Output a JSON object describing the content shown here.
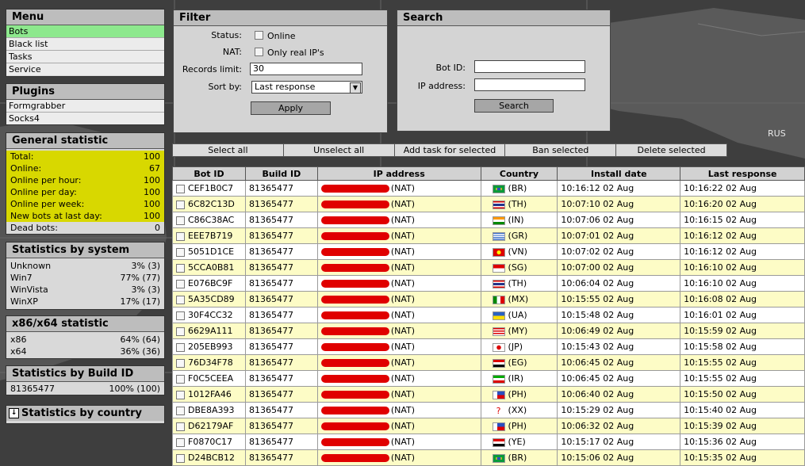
{
  "menu": {
    "title": "Menu",
    "items": [
      {
        "label": "Bots",
        "active": true
      },
      {
        "label": "Black list"
      },
      {
        "label": "Tasks"
      },
      {
        "label": "Service"
      }
    ]
  },
  "plugins": {
    "title": "Plugins",
    "items": [
      {
        "label": "Formgrabber"
      },
      {
        "label": "Socks4"
      }
    ]
  },
  "general": {
    "title": "General statistic",
    "rows": [
      {
        "label": "Total:",
        "value": "100"
      },
      {
        "label": "Online:",
        "value": "67"
      },
      {
        "label": "Online per hour:",
        "value": "100"
      },
      {
        "label": "Online per day:",
        "value": "100"
      },
      {
        "label": "Online per week:",
        "value": "100"
      },
      {
        "label": "New bots at last day:",
        "value": "100"
      },
      {
        "label": "Dead bots:",
        "value": "0"
      }
    ]
  },
  "bysystem": {
    "title": "Statistics by system",
    "rows": [
      {
        "label": "Unknown",
        "value": "3% (3)"
      },
      {
        "label": "Win7",
        "value": "77% (77)"
      },
      {
        "label": "WinVista",
        "value": "3% (3)"
      },
      {
        "label": "WinXP",
        "value": "17% (17)"
      }
    ]
  },
  "arch": {
    "title": "x86/x64 statistic",
    "rows": [
      {
        "label": "x86",
        "value": "64% (64)"
      },
      {
        "label": "x64",
        "value": "36% (36)"
      }
    ]
  },
  "bybuild": {
    "title": "Statistics by Build ID",
    "rows": [
      {
        "label": "81365477",
        "value": "100% (100)"
      }
    ]
  },
  "bycountry": {
    "title": "Statistics by country"
  },
  "filter": {
    "title": "Filter",
    "status_label": "Status:",
    "status_option": "Online",
    "nat_label": "NAT:",
    "nat_option": "Only real IP's",
    "limit_label": "Records limit:",
    "limit_value": "30",
    "sort_label": "Sort by:",
    "sort_value": "Last response",
    "apply": "Apply"
  },
  "search": {
    "title": "Search",
    "botid_label": "Bot ID:",
    "ip_label": "IP address:",
    "button": "Search"
  },
  "actions": [
    "Select all",
    "Unselect all",
    "Add task for selected",
    "Ban selected",
    "Delete selected"
  ],
  "grid": {
    "columns": [
      "Bot ID",
      "Build ID",
      "IP address",
      "Country",
      "Install date",
      "Last response"
    ],
    "rows": [
      {
        "id": "CEF1B0C7",
        "build": "81365477",
        "ip": "(NAT)",
        "cc": "(BR)",
        "flag": "br",
        "install": "10:16:12 02 Aug",
        "last": "10:16:22 02 Aug"
      },
      {
        "id": "6C82C13D",
        "build": "81365477",
        "ip": "(NAT)",
        "cc": "(TH)",
        "flag": "th",
        "install": "10:07:10 02 Aug",
        "last": "10:16:20 02 Aug"
      },
      {
        "id": "C86C38AC",
        "build": "81365477",
        "ip": "(NAT)",
        "cc": "(IN)",
        "flag": "in",
        "install": "10:07:06 02 Aug",
        "last": "10:16:15 02 Aug"
      },
      {
        "id": "EEE7B719",
        "build": "81365477",
        "ip": "(NAT)",
        "cc": "(GR)",
        "flag": "gr",
        "install": "10:07:01 02 Aug",
        "last": "10:16:12 02 Aug"
      },
      {
        "id": "5051D1CE",
        "build": "81365477",
        "ip": "(NAT)",
        "cc": "(VN)",
        "flag": "vn",
        "install": "10:07:02 02 Aug",
        "last": "10:16:12 02 Aug"
      },
      {
        "id": "5CCA0B81",
        "build": "81365477",
        "ip": "(NAT)",
        "cc": "(SG)",
        "flag": "sg",
        "install": "10:07:00 02 Aug",
        "last": "10:16:10 02 Aug"
      },
      {
        "id": "E076BC9F",
        "build": "81365477",
        "ip": "(NAT)",
        "cc": "(TH)",
        "flag": "th",
        "install": "10:06:04 02 Aug",
        "last": "10:16:10 02 Aug"
      },
      {
        "id": "5A35CD89",
        "build": "81365477",
        "ip": "(NAT)",
        "cc": "(MX)",
        "flag": "mx",
        "install": "10:15:55 02 Aug",
        "last": "10:16:08 02 Aug"
      },
      {
        "id": "30F4CC32",
        "build": "81365477",
        "ip": "(NAT)",
        "cc": "(UA)",
        "flag": "ua",
        "install": "10:15:48 02 Aug",
        "last": "10:16:01 02 Aug"
      },
      {
        "id": "6629A111",
        "build": "81365477",
        "ip": "(NAT)",
        "cc": "(MY)",
        "flag": "my",
        "install": "10:06:49 02 Aug",
        "last": "10:15:59 02 Aug"
      },
      {
        "id": "205EB993",
        "build": "81365477",
        "ip": "(NAT)",
        "cc": "(JP)",
        "flag": "jp",
        "install": "10:15:43 02 Aug",
        "last": "10:15:58 02 Aug"
      },
      {
        "id": "76D34F78",
        "build": "81365477",
        "ip": "(NAT)",
        "cc": "(EG)",
        "flag": "eg",
        "install": "10:06:45 02 Aug",
        "last": "10:15:55 02 Aug"
      },
      {
        "id": "F0C5CEEA",
        "build": "81365477",
        "ip": "(NAT)",
        "cc": "(IR)",
        "flag": "ir",
        "install": "10:06:45 02 Aug",
        "last": "10:15:55 02 Aug"
      },
      {
        "id": "1012FA46",
        "build": "81365477",
        "ip": "(NAT)",
        "cc": "(PH)",
        "flag": "ph",
        "install": "10:06:40 02 Aug",
        "last": "10:15:50 02 Aug"
      },
      {
        "id": "DBE8A393",
        "build": "81365477",
        "ip": "(NAT)",
        "cc": "(XX)",
        "flag": "xx",
        "install": "10:15:29 02 Aug",
        "last": "10:15:40 02 Aug"
      },
      {
        "id": "D62179AF",
        "build": "81365477",
        "ip": "(NAT)",
        "cc": "(PH)",
        "flag": "ph",
        "install": "10:06:32 02 Aug",
        "last": "10:15:39 02 Aug"
      },
      {
        "id": "F0870C17",
        "build": "81365477",
        "ip": "(NAT)",
        "cc": "(YE)",
        "flag": "ye",
        "install": "10:15:17 02 Aug",
        "last": "10:15:36 02 Aug"
      },
      {
        "id": "D24BCB12",
        "build": "81365477",
        "ip": "(NAT)",
        "cc": "(BR)",
        "flag": "br",
        "install": "10:15:06 02 Aug",
        "last": "10:15:35 02 Aug"
      }
    ]
  },
  "map_label": "RUS"
}
